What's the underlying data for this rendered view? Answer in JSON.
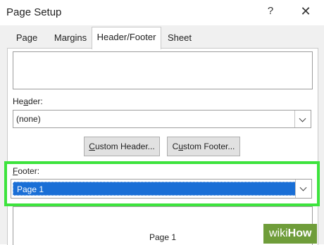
{
  "window": {
    "title": "Page Setup",
    "help_label": "?",
    "close_label": "✕"
  },
  "tabs": [
    {
      "label": "Page"
    },
    {
      "label": "Margins"
    },
    {
      "label": "Header/Footer"
    },
    {
      "label": "Sheet"
    }
  ],
  "active_tab": "Header/Footer",
  "header": {
    "label_pre": "He",
    "label_key": "a",
    "label_post": "der:",
    "value": "(none)"
  },
  "buttons": {
    "custom_header_key": "C",
    "custom_header_rest": "ustom Header...",
    "custom_footer_pre": "C",
    "custom_footer_key": "u",
    "custom_footer_rest": "stom Footer..."
  },
  "footer": {
    "label_key": "F",
    "label_rest": "ooter:",
    "value": "Page 1"
  },
  "footer_preview_text": "Page 1",
  "watermark": {
    "part1": "wiki",
    "part2": "How"
  },
  "colors": {
    "highlight": "#3de33d",
    "selection": "#1a6fd6"
  }
}
